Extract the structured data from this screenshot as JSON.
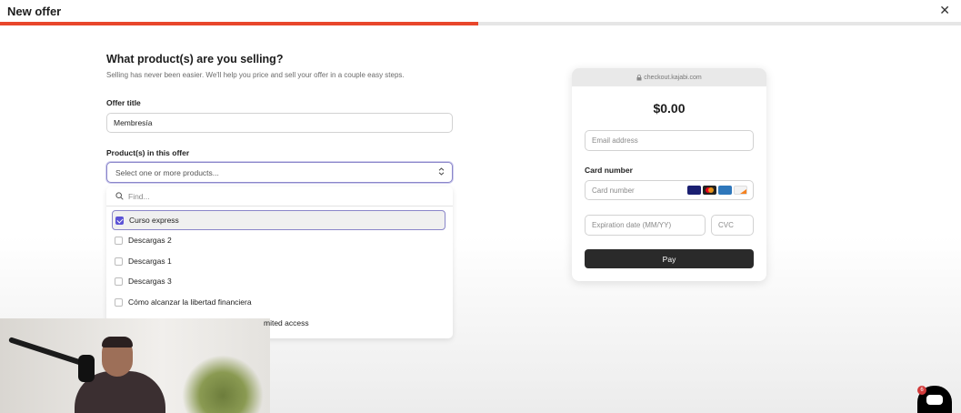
{
  "header": {
    "title": "New offer",
    "close_icon": "close-icon"
  },
  "progress": {
    "fraction": 0.5
  },
  "step": {
    "heading": "What product(s) are you selling?",
    "subheading": "Selling has never been easier. We'll help you price and sell your offer in a couple easy steps."
  },
  "form": {
    "offer_title_label": "Offer title",
    "offer_title_value": "Membresía",
    "products_label": "Product(s) in this offer",
    "products_placeholder": "Select one or more products...",
    "chevron_icon": "chevron-updown-icon"
  },
  "dropdown": {
    "find_placeholder": "Find...",
    "search_icon": "search-icon",
    "options": [
      {
        "label": "Curso express",
        "checked": true
      },
      {
        "label": "Descargas 2",
        "checked": false
      },
      {
        "label": "Descargas 1",
        "checked": false
      },
      {
        "label": "Descargas 3",
        "checked": false
      },
      {
        "label": "Cómo alcanzar la libertad financiera",
        "checked": false
      }
    ],
    "partial_option": "mited access"
  },
  "checkout": {
    "url": "checkout.kajabi.com",
    "price": "$0.00",
    "email_placeholder": "Email address",
    "card_label": "Card number",
    "card_placeholder": "Card number",
    "expiry_placeholder": "Expiration date (MM/YY)",
    "cvc_placeholder": "CVC",
    "pay_label": "Pay",
    "card_icons": [
      "visa-icon",
      "mastercard-icon",
      "amex-icon",
      "discover-icon"
    ]
  },
  "chat": {
    "badge": "6"
  },
  "colors": {
    "accent": "#e8462b",
    "selection": "#5b52d6",
    "pay": "#2a2a2a"
  }
}
